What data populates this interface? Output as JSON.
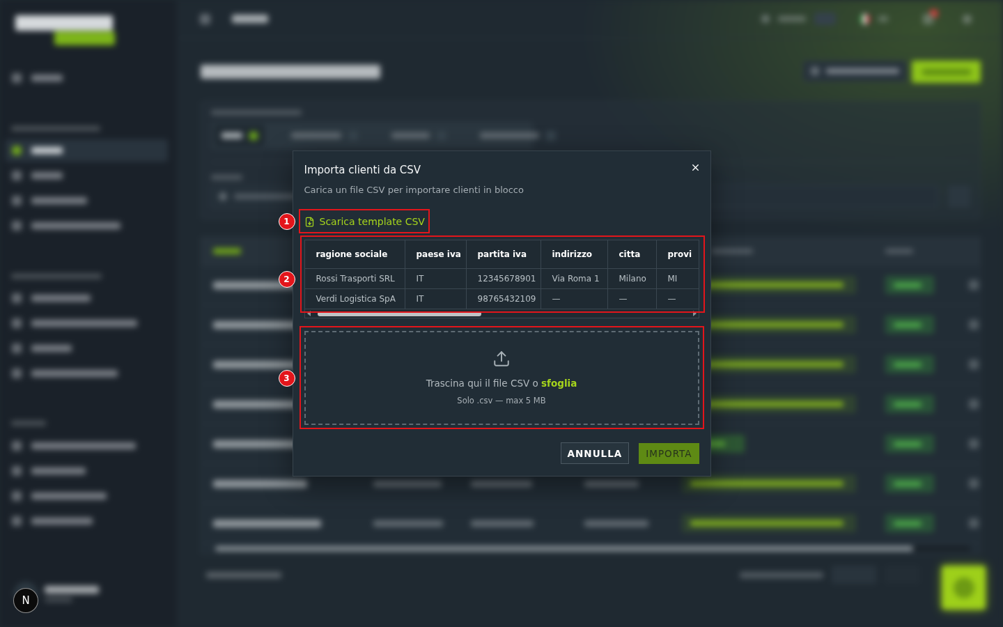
{
  "dialog": {
    "title": "Importa clienti da CSV",
    "subtitle": "Carica un file CSV per importare clienti in blocco",
    "template_link": {
      "label": "Scarica template CSV",
      "annotation": "1"
    },
    "preview_table": {
      "annotation": "2",
      "columns": [
        "ragione sociale",
        "paese iva",
        "partita iva",
        "indirizzo",
        "citta",
        "provi"
      ],
      "rows": [
        [
          "Rossi Trasporti SRL",
          "IT",
          "12345678901",
          "Via Roma 1",
          "Milano",
          "MI"
        ],
        [
          "Verdi Logistica SpA",
          "IT",
          "98765432109",
          "—",
          "—",
          "—"
        ]
      ]
    },
    "dropzone": {
      "annotation": "3",
      "prompt": "Trascina qui il file CSV o",
      "browse_link": "sfoglia",
      "hint": "Solo .csv — max 5 MB"
    },
    "buttons": [
      {
        "label": "ANNULLA",
        "kind": "secondary",
        "disabled": false
      },
      {
        "label": "IMPORTA",
        "kind": "primary",
        "disabled": true
      }
    ]
  },
  "dev_indicator": {
    "label": "N"
  }
}
